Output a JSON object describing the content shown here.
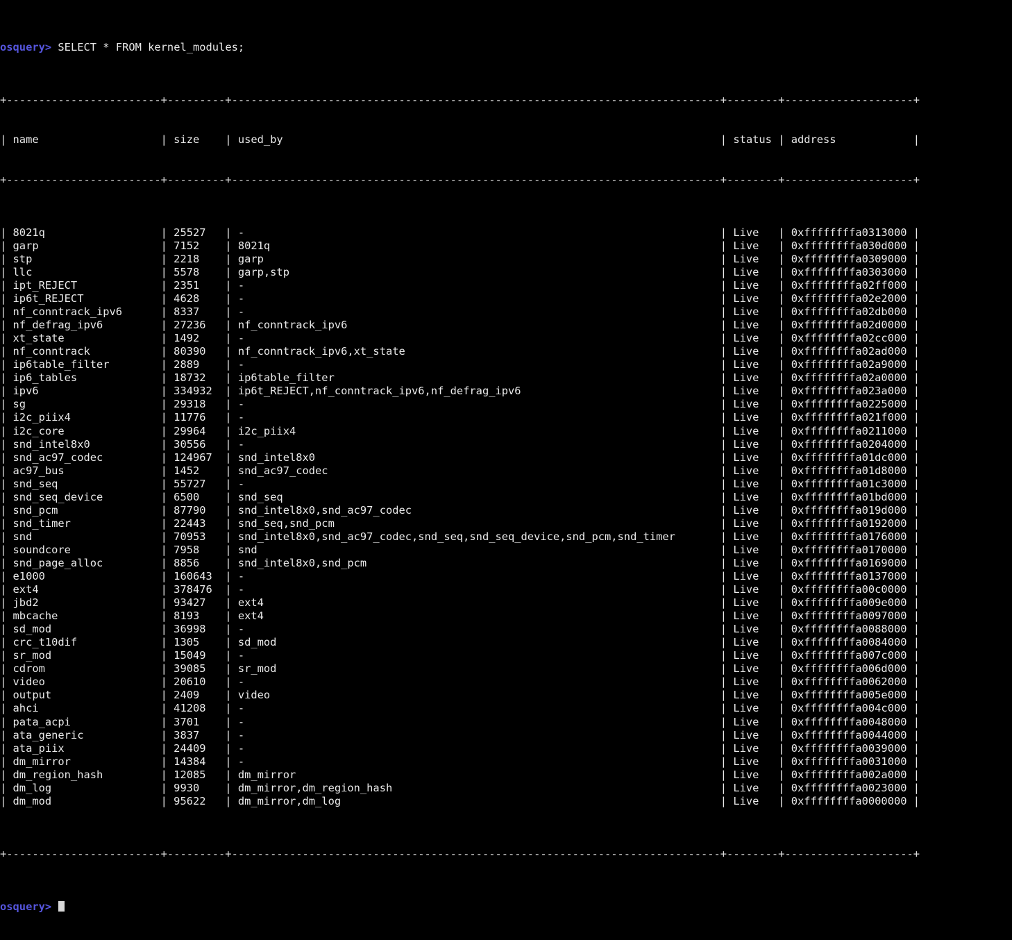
{
  "terminal": {
    "shell_name": "osquery",
    "prompt": "osquery>",
    "command": " SELECT * FROM kernel_modules;",
    "final_prompt": "osquery>",
    "colors": {
      "background": "#000000",
      "foreground": "#e8e8e8",
      "prompt": "#5555dd",
      "rule": "#dcdcdc"
    }
  },
  "table": {
    "separator_top": "+------------------------+---------+--------------------------------------------------------------------------+--------+--------------------+",
    "columns": [
      {
        "key": "name",
        "header": "name",
        "width": 22
      },
      {
        "key": "size",
        "header": "size",
        "width": 7
      },
      {
        "key": "used_by",
        "header": "used_by",
        "width": 74
      },
      {
        "key": "status",
        "header": "status",
        "width": 6
      },
      {
        "key": "address",
        "header": "address",
        "width": 18
      }
    ],
    "row_count": 44,
    "rows": [
      {
        "name": "8021q",
        "size": "25527",
        "used_by": "-",
        "status": "Live",
        "address": "0xffffffffa0313000"
      },
      {
        "name": "garp",
        "size": "7152",
        "used_by": "8021q",
        "status": "Live",
        "address": "0xffffffffa030d000"
      },
      {
        "name": "stp",
        "size": "2218",
        "used_by": "garp",
        "status": "Live",
        "address": "0xffffffffa0309000"
      },
      {
        "name": "llc",
        "size": "5578",
        "used_by": "garp,stp",
        "status": "Live",
        "address": "0xffffffffa0303000"
      },
      {
        "name": "ipt_REJECT",
        "size": "2351",
        "used_by": "-",
        "status": "Live",
        "address": "0xffffffffa02ff000"
      },
      {
        "name": "ip6t_REJECT",
        "size": "4628",
        "used_by": "-",
        "status": "Live",
        "address": "0xffffffffa02e2000"
      },
      {
        "name": "nf_conntrack_ipv6",
        "size": "8337",
        "used_by": "-",
        "status": "Live",
        "address": "0xffffffffa02db000"
      },
      {
        "name": "nf_defrag_ipv6",
        "size": "27236",
        "used_by": "nf_conntrack_ipv6",
        "status": "Live",
        "address": "0xffffffffa02d0000"
      },
      {
        "name": "xt_state",
        "size": "1492",
        "used_by": "-",
        "status": "Live",
        "address": "0xffffffffa02cc000"
      },
      {
        "name": "nf_conntrack",
        "size": "80390",
        "used_by": "nf_conntrack_ipv6,xt_state",
        "status": "Live",
        "address": "0xffffffffa02ad000"
      },
      {
        "name": "ip6table_filter",
        "size": "2889",
        "used_by": "-",
        "status": "Live",
        "address": "0xffffffffa02a9000"
      },
      {
        "name": "ip6_tables",
        "size": "18732",
        "used_by": "ip6table_filter",
        "status": "Live",
        "address": "0xffffffffa02a0000"
      },
      {
        "name": "ipv6",
        "size": "334932",
        "used_by": "ip6t_REJECT,nf_conntrack_ipv6,nf_defrag_ipv6",
        "status": "Live",
        "address": "0xffffffffa023a000"
      },
      {
        "name": "sg",
        "size": "29318",
        "used_by": "-",
        "status": "Live",
        "address": "0xffffffffa0225000"
      },
      {
        "name": "i2c_piix4",
        "size": "11776",
        "used_by": "-",
        "status": "Live",
        "address": "0xffffffffa021f000"
      },
      {
        "name": "i2c_core",
        "size": "29964",
        "used_by": "i2c_piix4",
        "status": "Live",
        "address": "0xffffffffa0211000"
      },
      {
        "name": "snd_intel8x0",
        "size": "30556",
        "used_by": "-",
        "status": "Live",
        "address": "0xffffffffa0204000"
      },
      {
        "name": "snd_ac97_codec",
        "size": "124967",
        "used_by": "snd_intel8x0",
        "status": "Live",
        "address": "0xffffffffa01dc000"
      },
      {
        "name": "ac97_bus",
        "size": "1452",
        "used_by": "snd_ac97_codec",
        "status": "Live",
        "address": "0xffffffffa01d8000"
      },
      {
        "name": "snd_seq",
        "size": "55727",
        "used_by": "-",
        "status": "Live",
        "address": "0xffffffffa01c3000"
      },
      {
        "name": "snd_seq_device",
        "size": "6500",
        "used_by": "snd_seq",
        "status": "Live",
        "address": "0xffffffffa01bd000"
      },
      {
        "name": "snd_pcm",
        "size": "87790",
        "used_by": "snd_intel8x0,snd_ac97_codec",
        "status": "Live",
        "address": "0xffffffffa019d000"
      },
      {
        "name": "snd_timer",
        "size": "22443",
        "used_by": "snd_seq,snd_pcm",
        "status": "Live",
        "address": "0xffffffffa0192000"
      },
      {
        "name": "snd",
        "size": "70953",
        "used_by": "snd_intel8x0,snd_ac97_codec,snd_seq,snd_seq_device,snd_pcm,snd_timer",
        "status": "Live",
        "address": "0xffffffffa0176000"
      },
      {
        "name": "soundcore",
        "size": "7958",
        "used_by": "snd",
        "status": "Live",
        "address": "0xffffffffa0170000"
      },
      {
        "name": "snd_page_alloc",
        "size": "8856",
        "used_by": "snd_intel8x0,snd_pcm",
        "status": "Live",
        "address": "0xffffffffa0169000"
      },
      {
        "name": "e1000",
        "size": "160643",
        "used_by": "-",
        "status": "Live",
        "address": "0xffffffffa0137000"
      },
      {
        "name": "ext4",
        "size": "378476",
        "used_by": "-",
        "status": "Live",
        "address": "0xffffffffa00c0000"
      },
      {
        "name": "jbd2",
        "size": "93427",
        "used_by": "ext4",
        "status": "Live",
        "address": "0xffffffffa009e000"
      },
      {
        "name": "mbcache",
        "size": "8193",
        "used_by": "ext4",
        "status": "Live",
        "address": "0xffffffffa0097000"
      },
      {
        "name": "sd_mod",
        "size": "36998",
        "used_by": "-",
        "status": "Live",
        "address": "0xffffffffa0088000"
      },
      {
        "name": "crc_t10dif",
        "size": "1305",
        "used_by": "sd_mod",
        "status": "Live",
        "address": "0xffffffffa0084000"
      },
      {
        "name": "sr_mod",
        "size": "15049",
        "used_by": "-",
        "status": "Live",
        "address": "0xffffffffa007c000"
      },
      {
        "name": "cdrom",
        "size": "39085",
        "used_by": "sr_mod",
        "status": "Live",
        "address": "0xffffffffa006d000"
      },
      {
        "name": "video",
        "size": "20610",
        "used_by": "-",
        "status": "Live",
        "address": "0xffffffffa0062000"
      },
      {
        "name": "output",
        "size": "2409",
        "used_by": "video",
        "status": "Live",
        "address": "0xffffffffa005e000"
      },
      {
        "name": "ahci",
        "size": "41208",
        "used_by": "-",
        "status": "Live",
        "address": "0xffffffffa004c000"
      },
      {
        "name": "pata_acpi",
        "size": "3701",
        "used_by": "-",
        "status": "Live",
        "address": "0xffffffffa0048000"
      },
      {
        "name": "ata_generic",
        "size": "3837",
        "used_by": "-",
        "status": "Live",
        "address": "0xffffffffa0044000"
      },
      {
        "name": "ata_piix",
        "size": "24409",
        "used_by": "-",
        "status": "Live",
        "address": "0xffffffffa0039000"
      },
      {
        "name": "dm_mirror",
        "size": "14384",
        "used_by": "-",
        "status": "Live",
        "address": "0xffffffffa0031000"
      },
      {
        "name": "dm_region_hash",
        "size": "12085",
        "used_by": "dm_mirror",
        "status": "Live",
        "address": "0xffffffffa002a000"
      },
      {
        "name": "dm_log",
        "size": "9930",
        "used_by": "dm_mirror,dm_region_hash",
        "status": "Live",
        "address": "0xffffffffa0023000"
      },
      {
        "name": "dm_mod",
        "size": "95622",
        "used_by": "dm_mirror,dm_log",
        "status": "Live",
        "address": "0xffffffffa0000000"
      }
    ]
  }
}
